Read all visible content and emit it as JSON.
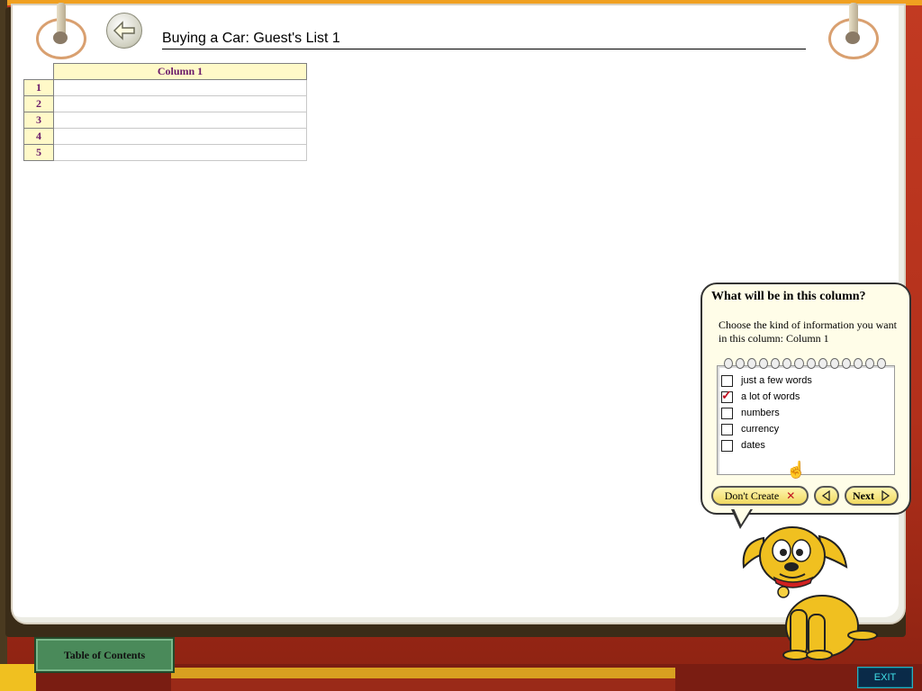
{
  "header": {
    "title": "Buying a Car: Guest's List  1"
  },
  "grid": {
    "column_header": "Column  1",
    "rows": [
      "1",
      "2",
      "3",
      "4",
      "5"
    ]
  },
  "dialog": {
    "title": "What will be in this column?",
    "description": "Choose the kind of information you want in this column: Column  1",
    "options": [
      {
        "label": "just a few words",
        "checked": false
      },
      {
        "label": "a lot of words",
        "checked": true
      },
      {
        "label": "numbers",
        "checked": false
      },
      {
        "label": "currency",
        "checked": false
      },
      {
        "label": "dates",
        "checked": false
      }
    ],
    "dont_create_label": "Don't Create",
    "next_label": "Next"
  },
  "footer": {
    "toc_label": "Table of Contents",
    "exit_label": "EXIT"
  },
  "colors": {
    "header_fill": "#fff9c8",
    "header_text": "#6a1a6a",
    "check": "#c01020",
    "desk": "#b8331f",
    "dog": "#f0c020"
  }
}
